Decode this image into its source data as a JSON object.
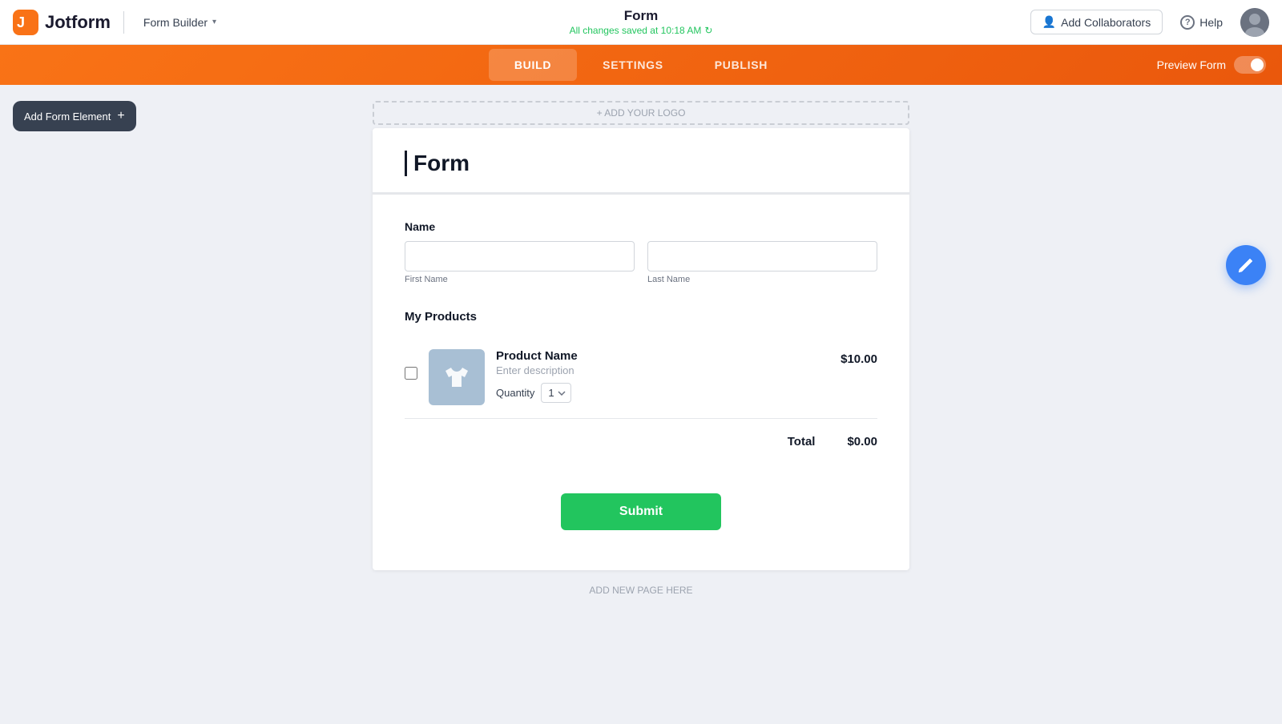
{
  "header": {
    "logo_text": "Jotform",
    "form_builder_label": "Form Builder",
    "form_title": "Form",
    "saved_status": "All changes saved at 10:18 AM",
    "add_collaborators_label": "Add Collaborators",
    "help_label": "Help"
  },
  "nav": {
    "tabs": [
      {
        "id": "build",
        "label": "BUILD",
        "active": true
      },
      {
        "id": "settings",
        "label": "SETTINGS",
        "active": false
      },
      {
        "id": "publish",
        "label": "PUBLISH",
        "active": false
      }
    ],
    "preview_label": "Preview Form"
  },
  "add_element": {
    "label": "Add Form Element"
  },
  "form": {
    "add_logo_label": "+ ADD YOUR LOGO",
    "title": "Form",
    "fields": {
      "name": {
        "label": "Name",
        "first_name_placeholder": "",
        "first_name_sublabel": "First Name",
        "last_name_placeholder": "",
        "last_name_sublabel": "Last Name"
      }
    },
    "products": {
      "section_label": "My Products",
      "items": [
        {
          "name": "Product Name",
          "description": "Enter description",
          "price": "$10.00",
          "quantity_label": "Quantity",
          "quantity_value": "1"
        }
      ],
      "total_label": "Total",
      "total_value": "$0.00"
    },
    "submit_label": "Submit"
  },
  "add_page_label": "ADD NEW PAGE HERE",
  "icons": {
    "chevron_down": "▾",
    "person": "👤",
    "question": "?",
    "plus": "+",
    "pencil": "✎",
    "refresh": "↻"
  }
}
